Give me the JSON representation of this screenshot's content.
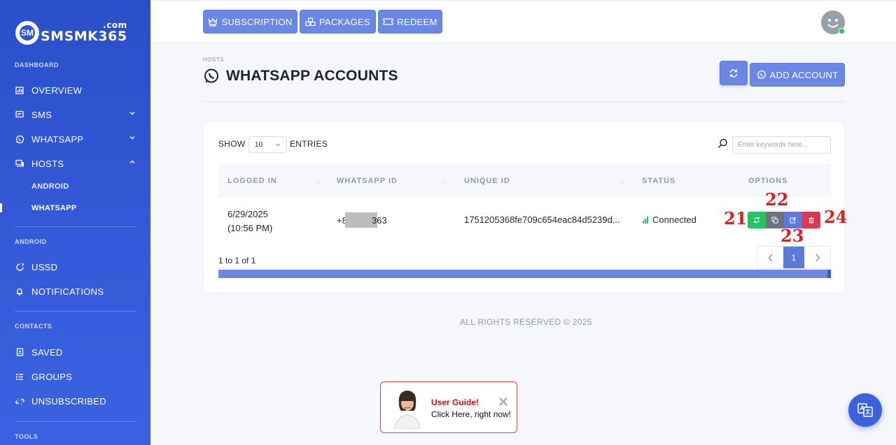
{
  "brand": {
    "name": "SMSMK365",
    "tld": ".com",
    "logo_glyph": "SM"
  },
  "sidebar": {
    "sections": {
      "dashboard": "DASHBOARD",
      "android": "ANDROID",
      "contacts": "CONTACTS",
      "tools": "TOOLS"
    },
    "items": {
      "overview": "OVERVIEW",
      "sms": "SMS",
      "whatsapp": "WHATSAPP",
      "hosts": "HOSTS",
      "hosts_android": "ANDROID",
      "hosts_whatsapp": "WHATSAPP",
      "ussd": "USSD",
      "notifications": "NOTIFICATIONS",
      "saved": "SAVED",
      "groups": "GROUPS",
      "unsubscribed": "UNSUBSCRIBED"
    }
  },
  "topbar": {
    "subscription": "SUBSCRIPTION",
    "packages": "PACKAGES",
    "redeem": "REDEEM"
  },
  "page": {
    "breadcrumb": "HOSTS",
    "title": "WHATSAPP ACCOUNTS",
    "add_account": "ADD ACCOUNT"
  },
  "table": {
    "show_label": "SHOW",
    "entries_value": "10",
    "entries_label": "ENTRIES",
    "search_placeholder": "Enter keywords here...",
    "columns": {
      "logged_in": "LOGGED IN",
      "whatsapp_id": "WHATSAPP ID",
      "unique_id": "UNIQUE ID",
      "status": "STATUS",
      "options": "OPTIONS"
    },
    "rows": [
      {
        "date": "6/29/2025",
        "time": "(10:56 PM)",
        "whatsapp_prefix": "+84",
        "whatsapp_suffix": "363",
        "unique_id": "1751205368fe709c654eac84d5239d...",
        "status": "Connected"
      }
    ],
    "pagination_info": "1 to 1 of 1",
    "current_page": "1"
  },
  "annotations": {
    "a21": "21",
    "a22": "22",
    "a23": "23",
    "a24": "24"
  },
  "footer": {
    "text": "ALL RIGHTS RESERVED © 2025"
  },
  "guide": {
    "title": "User Guide!",
    "subtitle": "Click Here, right now!"
  },
  "colors": {
    "sidebar": "#2f55d4",
    "primary_btn": "#6a88e3",
    "status_green": "#22c55e",
    "btn_green": "#22c55e",
    "btn_gray": "#6b7280",
    "btn_blue": "#5b7adb",
    "btn_red": "#e0364f",
    "annotation_red": "#e31d1d"
  }
}
